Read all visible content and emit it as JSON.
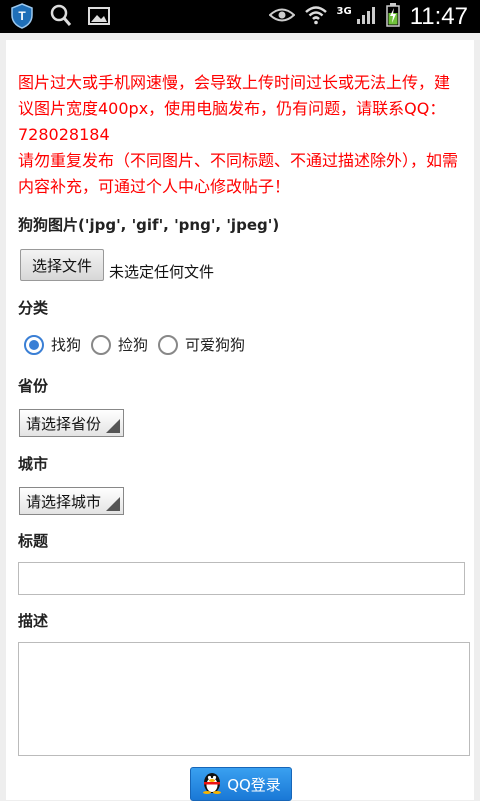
{
  "status_bar": {
    "network": "3G",
    "time": "11:47"
  },
  "notice": {
    "line1": "图片过大或手机网速慢，会导致上传时间过长或无法上传，建议图片宽度400px，使用电脑发布，仍有问题，请联系QQ：728028184",
    "line2": "请勿重复发布（不同图片、不同标题、不通过描述除外），如需内容补充，可通过个人中心修改帖子！"
  },
  "form": {
    "picture_label": "狗狗图片('jpg', 'gif', 'png', 'jpeg')",
    "file_button": "选择文件",
    "file_status": "未选定任何文件",
    "category_label": "分类",
    "categories": [
      {
        "label": "找狗",
        "selected": true
      },
      {
        "label": "捡狗",
        "selected": false
      },
      {
        "label": "可爱狗狗",
        "selected": false
      }
    ],
    "province_label": "省份",
    "province_select": "请选择省份",
    "city_label": "城市",
    "city_select": "请选择城市",
    "title_label": "标题",
    "title_value": "",
    "description_label": "描述",
    "description_value": "",
    "qq_login": "QQ登录"
  },
  "colors": {
    "notice": "#ff0000",
    "radio_selected": "#3a7fd5",
    "qq_button": "#2a8ee6"
  }
}
